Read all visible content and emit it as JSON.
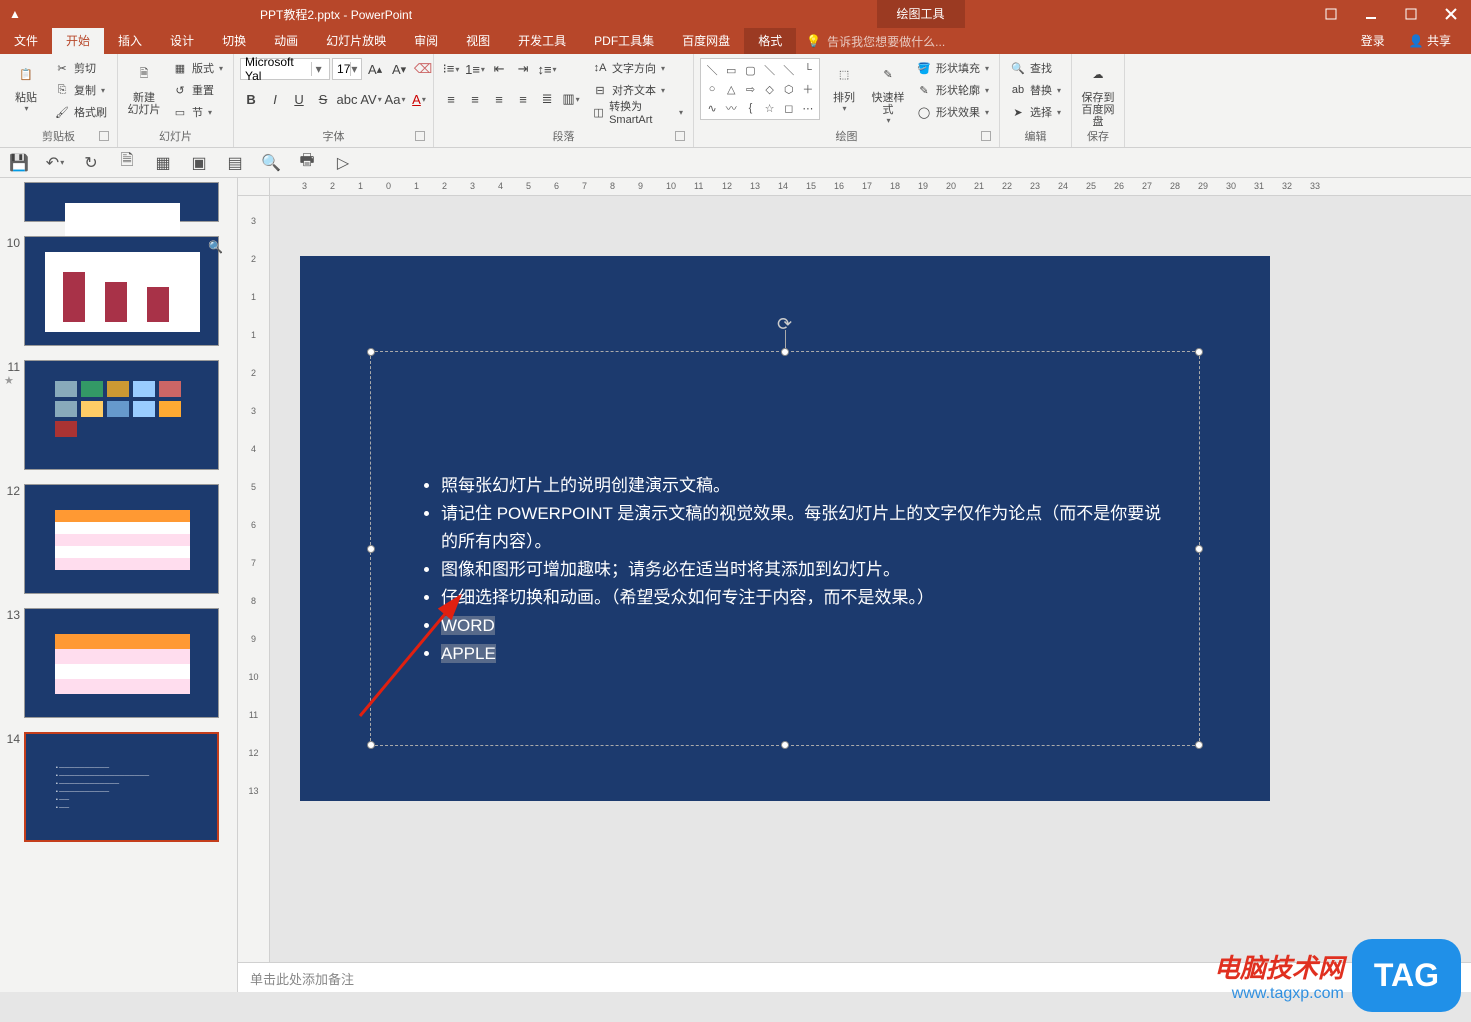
{
  "app": {
    "title": "PPT教程2.pptx - PowerPoint",
    "drawing_tools": "绘图工具"
  },
  "tabs": {
    "file": "文件",
    "home": "开始",
    "insert": "插入",
    "design": "设计",
    "transitions": "切换",
    "animations": "动画",
    "slideshow": "幻灯片放映",
    "review": "审阅",
    "view": "视图",
    "developer": "开发工具",
    "pdf": "PDF工具集",
    "baidu": "百度网盘",
    "format": "格式",
    "tellme": "告诉我您想要做什么...",
    "login": "登录",
    "share": "共享"
  },
  "ribbon": {
    "clipboard": {
      "paste": "粘贴",
      "cut": "剪切",
      "copy": "复制",
      "format_painter": "格式刷",
      "group": "剪贴板"
    },
    "slides": {
      "new_slide": "新建\n幻灯片",
      "layout": "版式",
      "reset": "重置",
      "section": "节",
      "group": "幻灯片"
    },
    "font": {
      "name": "Microsoft Yal",
      "size": "17",
      "group": "字体"
    },
    "paragraph": {
      "text_dir": "文字方向",
      "align_text": "对齐文本",
      "smartart": "转换为 SmartArt",
      "group": "段落"
    },
    "drawing": {
      "arrange": "排列",
      "quick_styles": "快速样式",
      "shape_fill": "形状填充",
      "shape_outline": "形状轮廓",
      "shape_effects": "形状效果",
      "group": "绘图"
    },
    "editing": {
      "find": "查找",
      "replace": "替换",
      "select": "选择",
      "group": "编辑"
    },
    "save": {
      "save_to": "保存到\n百度网盘",
      "group": "保存"
    }
  },
  "thumbs": [
    {
      "num": "10"
    },
    {
      "num": "11"
    },
    {
      "num": "12"
    },
    {
      "num": "13"
    },
    {
      "num": "14"
    }
  ],
  "slide": {
    "bullets": [
      "照每张幻灯片上的说明创建演示文稿。",
      "请记住 POWERPOINT 是演示文稿的视觉效果。每张幻灯片上的文字仅作为论点（而不是你要说的所有内容）。",
      "图像和图形可增加趣味；请务必在适当时将其添加到幻灯片。",
      "仔细选择切换和动画。（希望受众如何专注于内容，而不是效果。）",
      "WORD",
      "APPLE"
    ]
  },
  "notes": {
    "placeholder": "单击此处添加备注"
  },
  "ruler_h": [
    "3",
    "2",
    "1",
    "0",
    "1",
    "2",
    "3",
    "4",
    "5",
    "6",
    "7",
    "8",
    "9",
    "10",
    "11",
    "12",
    "13",
    "14",
    "15",
    "16",
    "17",
    "18",
    "19",
    "20",
    "21",
    "22",
    "23",
    "24",
    "25",
    "26",
    "27",
    "28",
    "29",
    "30",
    "31",
    "32",
    "33"
  ],
  "ruler_v": [
    "3",
    "2",
    "1",
    "1",
    "2",
    "3",
    "4",
    "5",
    "6",
    "7",
    "8",
    "9",
    "10",
    "11",
    "12",
    "13"
  ],
  "watermark": {
    "line1": "电脑技术网",
    "line2": "www.tagxp.com",
    "tag": "TAG"
  }
}
